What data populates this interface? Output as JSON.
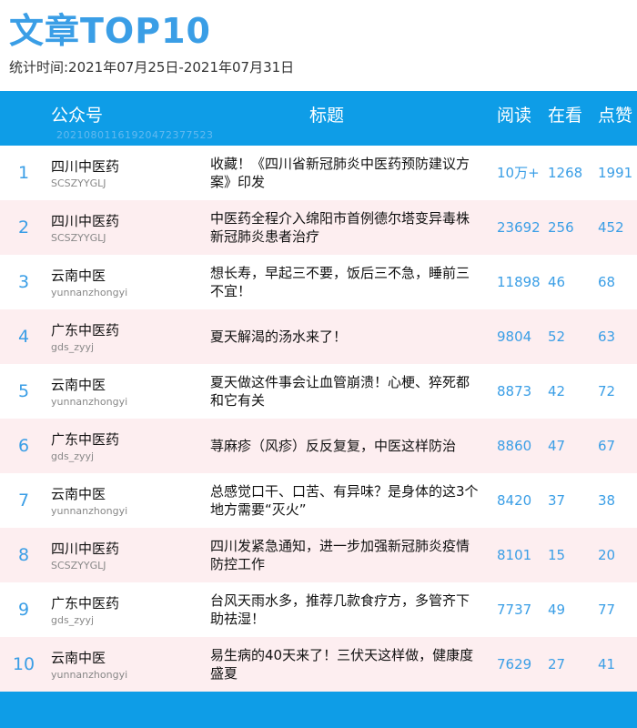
{
  "page": {
    "title": "文章TOP10",
    "period": "统计时间:2021年07月25日-2021年07月31日"
  },
  "header": {
    "account": "公众号",
    "title": "标题",
    "reads": "阅读",
    "views": "在看",
    "likes": "点赞",
    "id": "20210801161920472377523"
  },
  "colors": {
    "accent": "#0e9de7",
    "text_blue": "#3a9ee6",
    "even_row": "#fdeef0"
  },
  "rows": [
    {
      "rank": "1",
      "account": "四川中医药",
      "handle": "SCSZYYGLJ",
      "title": "收藏！《四川省新冠肺炎中医药预防建议方案》印发",
      "reads": "10万+",
      "views": "1268",
      "likes": "1991"
    },
    {
      "rank": "2",
      "account": "四川中医药",
      "handle": "SCSZYYGLJ",
      "title": "中医药全程介入绵阳市首例德尔塔变异毒株新冠肺炎患者治疗",
      "reads": "23692",
      "views": "256",
      "likes": "452"
    },
    {
      "rank": "3",
      "account": "云南中医",
      "handle": "yunnanzhongyi",
      "title": "想长寿，早起三不要，饭后三不急，睡前三不宜！",
      "reads": "11898",
      "views": "46",
      "likes": "68"
    },
    {
      "rank": "4",
      "account": "广东中医药",
      "handle": "gds_zyyj",
      "title": "夏天解渴的汤水来了！",
      "reads": "9804",
      "views": "52",
      "likes": "63"
    },
    {
      "rank": "5",
      "account": "云南中医",
      "handle": "yunnanzhongyi",
      "title": "夏天做这件事会让血管崩溃！心梗、猝死都和它有关",
      "reads": "8873",
      "views": "42",
      "likes": "72"
    },
    {
      "rank": "6",
      "account": "广东中医药",
      "handle": "gds_zyyj",
      "title": "荨麻疹（风疹）反反复复，中医这样防治",
      "reads": "8860",
      "views": "47",
      "likes": "67"
    },
    {
      "rank": "7",
      "account": "云南中医",
      "handle": "yunnanzhongyi",
      "title": "总感觉口干、口苦、有异味？是身体的这3个地方需要“灭火”",
      "reads": "8420",
      "views": "37",
      "likes": "38"
    },
    {
      "rank": "8",
      "account": "四川中医药",
      "handle": "SCSZYYGLJ",
      "title": "四川发紧急通知，进一步加强新冠肺炎疫情防控工作",
      "reads": "8101",
      "views": "15",
      "likes": "20"
    },
    {
      "rank": "9",
      "account": "广东中医药",
      "handle": "gds_zyyj",
      "title": "台风天雨水多，推荐几款食疗方，多管齐下助祛湿！",
      "reads": "7737",
      "views": "49",
      "likes": "77"
    },
    {
      "rank": "10",
      "account": "云南中医",
      "handle": "yunnanzhongyi",
      "title": "易生病的40天来了！三伏天这样做，健康度盛夏",
      "reads": "7629",
      "views": "27",
      "likes": "41"
    }
  ]
}
